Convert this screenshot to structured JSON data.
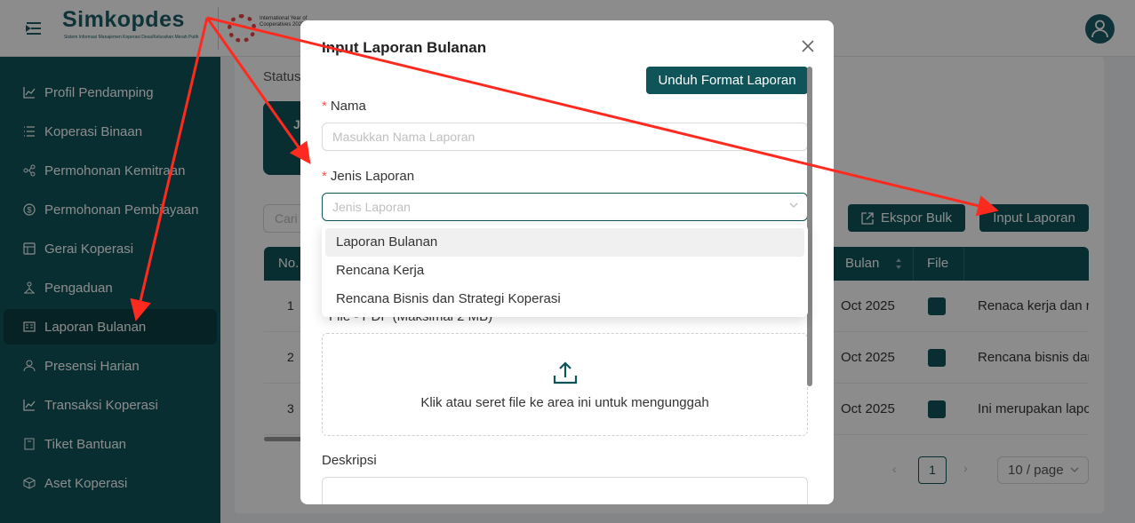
{
  "app": {
    "logo_text": "Simkopdes",
    "logo_sub": "Sistem Informasi Manajemen Koperasi Desa/Kelurahan Merah Putih",
    "iyc_text": "International Year of Cooperatives 2025"
  },
  "sidebar": {
    "items": [
      {
        "label": "Profil Pendamping",
        "icon": "chart-icon"
      },
      {
        "label": "Koperasi Binaan",
        "icon": "list-icon"
      },
      {
        "label": "Permohonan Kemitraan",
        "icon": "nodes-icon"
      },
      {
        "label": "Permohonan Pembiayaan",
        "icon": "dollar-icon"
      },
      {
        "label": "Gerai Koperasi",
        "icon": "store-icon"
      },
      {
        "label": "Pengaduan",
        "icon": "hierarchy-icon"
      },
      {
        "label": "Laporan Bulanan",
        "icon": "report-icon"
      },
      {
        "label": "Presensi Harian",
        "icon": "user-icon"
      },
      {
        "label": "Transaksi Koperasi",
        "icon": "chart-icon"
      },
      {
        "label": "Tiket Bantuan",
        "icon": "ticket-icon"
      },
      {
        "label": "Aset Koperasi",
        "icon": "box-icon"
      }
    ],
    "active_index": 6
  },
  "main": {
    "status_label": "Status",
    "stat_card_text": "Je",
    "search_placeholder": "Cari",
    "ekspor_label": "Ekspor Bulk",
    "input_label": "Input Laporan",
    "table": {
      "headers": [
        "No.",
        "Bulan",
        "File"
      ],
      "rows": [
        {
          "no": "1",
          "bulan": "Oct 2025",
          "desc": "Renaca kerja dan re"
        },
        {
          "no": "2",
          "bulan": "Oct 2025",
          "desc": "Rencana bisnis dan"
        },
        {
          "no": "3",
          "bulan": "Oct 2025",
          "desc": "Ini merupakan lapo"
        }
      ]
    },
    "pagination": {
      "current": "1",
      "page_size": "10 / page"
    }
  },
  "modal": {
    "title": "Input Laporan Bulanan",
    "unduh_label": "Unduh Format Laporan",
    "nama_label": "Nama",
    "nama_placeholder": "Masukkan Nama Laporan",
    "jenis_label": "Jenis Laporan",
    "jenis_placeholder": "Jenis Laporan",
    "file_label": "File - PDF (Maksimal 2 MB)",
    "upload_text": "Klik atau seret file ke area ini untuk mengunggah",
    "deskripsi_label": "Deskripsi",
    "required_mark": "*"
  },
  "dropdown": {
    "options": [
      "Laporan Bulanan",
      "Rencana Kerja",
      "Rencana Bisnis dan Strategi Koperasi"
    ],
    "highlighted_index": 0
  },
  "colors": {
    "primary": "#0f5459",
    "annotation": "#ff2a1f",
    "required": "#ff4d4f"
  }
}
